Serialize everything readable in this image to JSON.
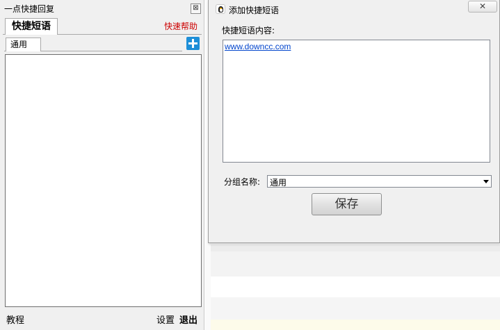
{
  "left_window": {
    "title": "一点快捷回复",
    "close_glyph": "⊠",
    "main_tab": "快捷短语",
    "help_link": "快速帮助",
    "sub_tab": "通用",
    "add_icon": "plus-square-icon",
    "footer": {
      "tutorial": "教程",
      "settings": "设置",
      "exit": "退出"
    },
    "help_color": "#cc0000",
    "add_color": "#1e8fd8"
  },
  "dialog": {
    "title": "添加快捷短语",
    "title_icon": "penguin-icon",
    "close_glyph": "✕",
    "content_label": "快捷短语内容:",
    "content_value": "www.downcc.com",
    "group_label": "分组名称:",
    "group_value": "通用",
    "save_label": "保存",
    "link_color": "#0044cc"
  }
}
